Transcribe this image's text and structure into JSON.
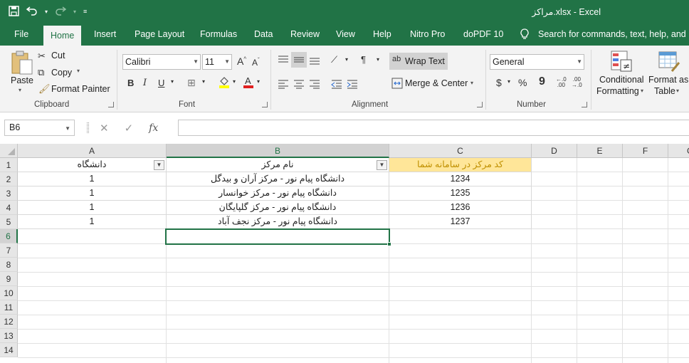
{
  "window": {
    "title": "مراکز.xlsx  -  Excel"
  },
  "ribbon_tabs": [
    "File",
    "Home",
    "Insert",
    "Page Layout",
    "Formulas",
    "Data",
    "Review",
    "View",
    "Help",
    "Nitro Pro",
    "doPDF 10"
  ],
  "search": {
    "placeholder": "Search for commands, text, help, and more"
  },
  "clipboard": {
    "paste": "Paste",
    "cut": "Cut",
    "copy": "Copy",
    "format_painter": "Format Painter",
    "label": "Clipboard"
  },
  "font": {
    "name": "Calibri",
    "size": "11",
    "label": "Font",
    "bold": "B",
    "italic": "I",
    "underline": "U"
  },
  "alignment": {
    "wrap_text": "Wrap Text",
    "merge_center": "Merge & Center",
    "label": "Alignment"
  },
  "number": {
    "format": "General",
    "label": "Number",
    "currency": "$",
    "percent": "%",
    "comma": "9"
  },
  "styles": {
    "conditional": "Conditional",
    "formatting": "Formatting",
    "format_as": "Format as",
    "table": "Table"
  },
  "formula_bar": {
    "name_box": "B6",
    "fx": "fx",
    "value": ""
  },
  "grid": {
    "columns": [
      "A",
      "B",
      "C",
      "D",
      "E",
      "F",
      "G"
    ],
    "rows": [
      "1",
      "2",
      "3",
      "4",
      "5",
      "6",
      "7",
      "8",
      "9",
      "10",
      "11",
      "12",
      "13",
      "14"
    ],
    "header": {
      "a": "دانشگاه",
      "b": "نام مرکز",
      "c": "کد مرکز در سامانه شما"
    },
    "data": [
      {
        "a": "1",
        "b": "دانشگاه پیام نور - مرکز  آران و بیدگل",
        "c": "1234"
      },
      {
        "a": "1",
        "b": "دانشگاه پیام نور - مرکز  خوانسار",
        "c": "1235"
      },
      {
        "a": "1",
        "b": "دانشگاه پیام نور - مرکز  گلپایگان",
        "c": "1236"
      },
      {
        "a": "1",
        "b": "دانشگاه پیام نور - مرکز  نجف آباد",
        "c": "1237"
      }
    ]
  },
  "colors": {
    "accent": "#217346",
    "header_fill": "#ffe699",
    "header_text": "#bf8f00"
  }
}
